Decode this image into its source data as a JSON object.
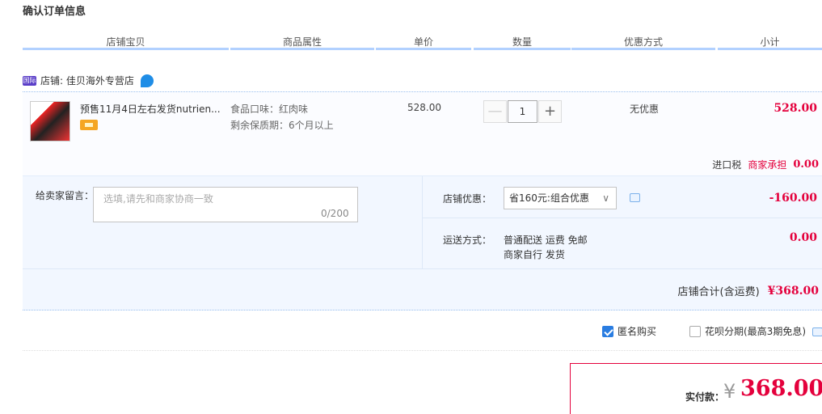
{
  "page_title": "确认订单信息",
  "columns": [
    "店铺宝贝",
    "商品属性",
    "单价",
    "数量",
    "优惠方式",
    "小计"
  ],
  "shop": {
    "badge": "国际",
    "label": "店铺: 佳贝海外专营店"
  },
  "item": {
    "name": "预售11月4日左右发货nutrien...",
    "attr_flavor": "食品口味：红肉味",
    "attr_shelf": "剩余保质期：6个月以上",
    "unit_price": "528.00",
    "quantity": "1",
    "minus": "—",
    "plus": "+",
    "promo": "无优惠",
    "subtotal": "528.00"
  },
  "tax": {
    "label": "进口税",
    "note": "商家承担",
    "value": "0.00"
  },
  "message": {
    "label": "给卖家留言：",
    "placeholder": "选填,请先和商家协商一致",
    "counter": "0/200"
  },
  "shop_discount": {
    "label": "店铺优惠：",
    "selected": "省160元:组合优惠",
    "chevron": "∨",
    "value": "-160.00"
  },
  "shipping": {
    "label": "运送方式：",
    "line1": "普通配送 运费 免邮",
    "line2": "商家自行  发货",
    "value": "0.00"
  },
  "shop_total": {
    "label": "店铺合计(含运费)",
    "value": "¥368.00"
  },
  "options": {
    "anonymous": "匿名购买",
    "installment": "花呗分期(最高3期免息)"
  },
  "payment": {
    "label": "实付款：",
    "currency": "¥",
    "value": "368.00"
  },
  "colors": {
    "accent_red": "#e4003c",
    "header_line": "#b2d1ff",
    "checkbox_blue": "#2a7de1"
  },
  "icons": [
    "shop-badge-icon",
    "wangwang-chat-icon",
    "gold-card-icon",
    "message-icon",
    "checkbox-checked-icon",
    "checkbox-empty-icon"
  ]
}
